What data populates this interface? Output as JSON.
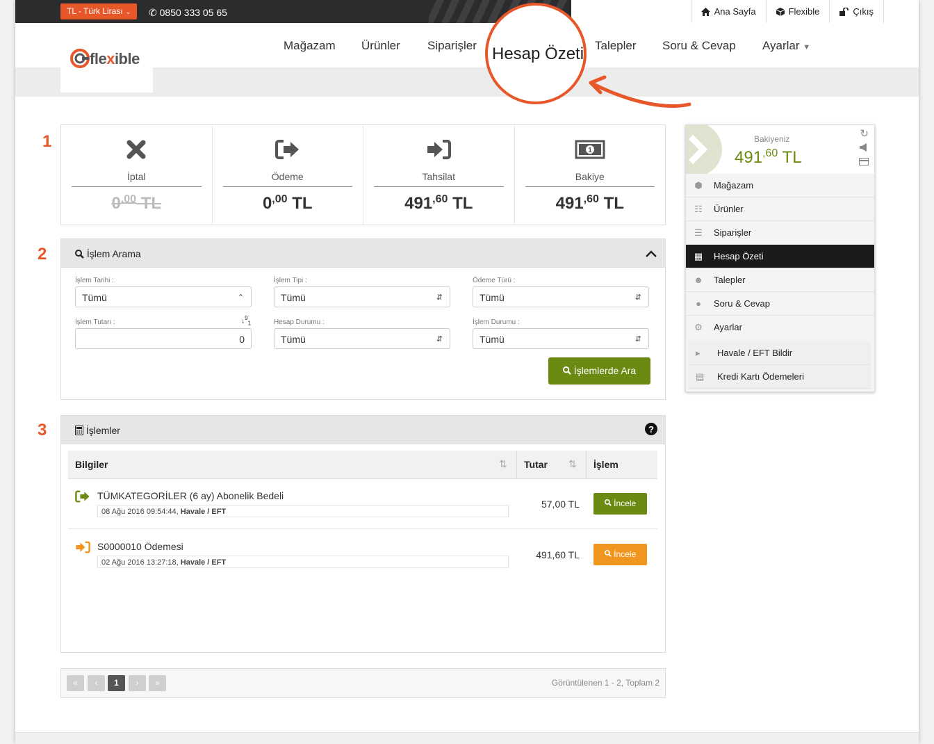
{
  "topbar": {
    "currency": "TL - Türk Lirası",
    "phone": "0850 333 05 65",
    "links": [
      {
        "label": "Ana Sayfa",
        "icon": "home-icon"
      },
      {
        "label": "Flexible",
        "icon": "cube-icon"
      },
      {
        "label": "Çıkış",
        "icon": "unlock-icon"
      }
    ]
  },
  "brand": {
    "prefix": "fle",
    "x": "x",
    "suffix": "ible",
    "accent": "#e8572a"
  },
  "nav": [
    "Mağazam",
    "Ürünler",
    "Siparişler",
    "Hesap Özeti",
    "Talepler",
    "Soru & Cevap",
    "Ayarlar"
  ],
  "steps": [
    "1",
    "2",
    "3"
  ],
  "summary": [
    {
      "label": "İptal",
      "int": "0",
      "dec": ",00",
      "cur": "TL",
      "icon": "times-icon"
    },
    {
      "label": "Ödeme",
      "int": "0",
      "dec": ",00",
      "cur": "TL",
      "icon": "sign-out-icon"
    },
    {
      "label": "Tahsilat",
      "int": "491",
      "dec": ",60",
      "cur": "TL",
      "icon": "sign-in-icon"
    },
    {
      "label": "Bakiye",
      "int": "491",
      "dec": ",60",
      "cur": "TL",
      "icon": "money-icon"
    }
  ],
  "search": {
    "title": "İşlem Arama",
    "fields": [
      {
        "label": "İşlem Tarihi :",
        "value": "Tümü"
      },
      {
        "label": "İşlem Tipi :",
        "value": "Tümü"
      },
      {
        "label": "Ödeme Türü :",
        "value": "Tümü"
      },
      {
        "label": "İşlem Tutarı :",
        "value": "0"
      },
      {
        "label": "Hesap Durumu :",
        "value": "Tümü"
      },
      {
        "label": "İşlem Durumu :",
        "value": "Tümü"
      }
    ],
    "button": "İşlemlerde Ara"
  },
  "transactions": {
    "title": "İşlemler",
    "columns": [
      "Bilgiler",
      "Tutar",
      "İşlem"
    ],
    "rows": [
      {
        "title": "TÜMKATEGORİLER (6 ay) Abonelik Bedeli",
        "date": "08 Ağu 2016 09:54:44,",
        "method": "Havale / EFT",
        "amount": "57,00 TL",
        "action": "İncele",
        "color": "#6b8a12"
      },
      {
        "title": "S0000010 Ödemesi",
        "date": "02 Ağu 2016 13:27:18,",
        "method": "Havale / EFT",
        "amount": "491,60 TL",
        "action": "İncele",
        "color": "#f0961e"
      }
    ]
  },
  "pager": {
    "first": "«",
    "prev": "‹",
    "current": "1",
    "next": "›",
    "last": "»",
    "info": "Görüntülenen 1 - 2, Toplam 2"
  },
  "sidebar": {
    "balance_label": "Bakiyeniz",
    "balance_int": "491",
    "balance_dec": ",60",
    "balance_cur": "TL",
    "items": [
      "Mağazam",
      "Ürünler",
      "Siparişler",
      "Hesap Özeti",
      "Talepler",
      "Soru & Cevap",
      "Ayarlar"
    ],
    "sub_items": [
      "Havale / EFT Bildir",
      "Kredi Kartı Ödemeleri"
    ]
  }
}
